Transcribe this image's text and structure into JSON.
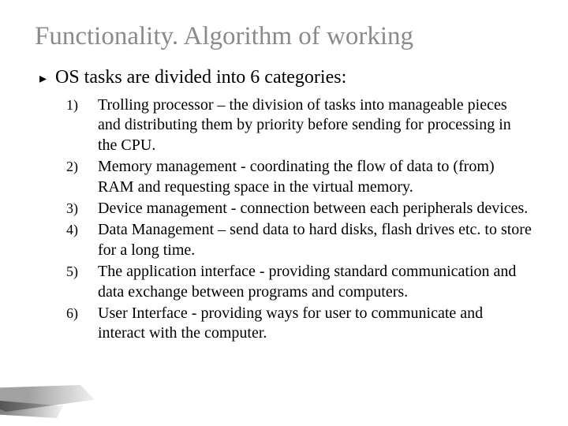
{
  "title": "Functionality. Algorithm of working",
  "intro": {
    "bullet": "▸",
    "text": "OS tasks are divided into 6 categories:"
  },
  "items": [
    {
      "num": "1)",
      "text": "Trolling processor – the division of tasks into manageable pieces and distributing them by priority before sending for processing in the CPU."
    },
    {
      "num": "2)",
      "text": "Memory management - coordinating the flow of data to (from) RAM and requesting space in the virtual memory."
    },
    {
      "num": "3)",
      "text": "Device management - connection between each peripherals devices."
    },
    {
      "num": "4)",
      "text": "Data Management – send data to hard disks, flash drives etc. to store for a long time."
    },
    {
      "num": "5)",
      "text": "The application interface - providing standard communication and data exchange between programs and computers."
    },
    {
      "num": "6)",
      "text": "User Interface - providing ways for user to communicate and interact with the computer."
    }
  ]
}
